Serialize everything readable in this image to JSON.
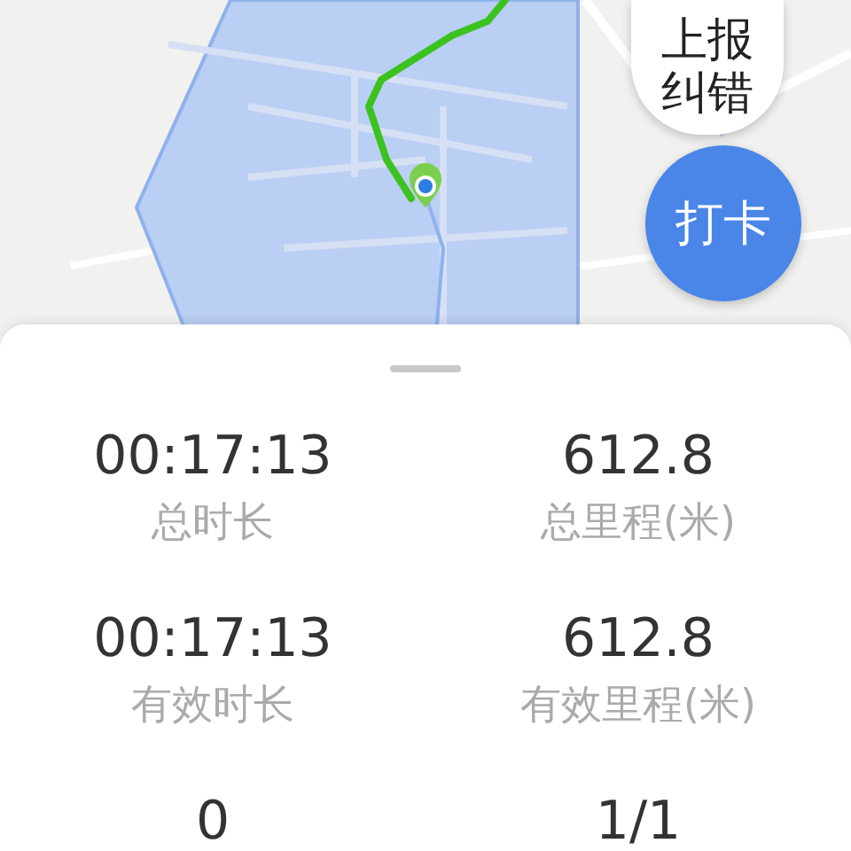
{
  "report_button": {
    "label": "上报纠错"
  },
  "checkin_button": {
    "label": "打卡"
  },
  "stats": [
    {
      "value": "00:17:13",
      "label": "总时长"
    },
    {
      "value": "612.8",
      "label": "总里程(米)"
    },
    {
      "value": "00:17:13",
      "label": "有效时长"
    },
    {
      "value": "612.8",
      "label": "有效里程(米)"
    },
    {
      "value": "0"
    },
    {
      "value": "1/1"
    }
  ]
}
